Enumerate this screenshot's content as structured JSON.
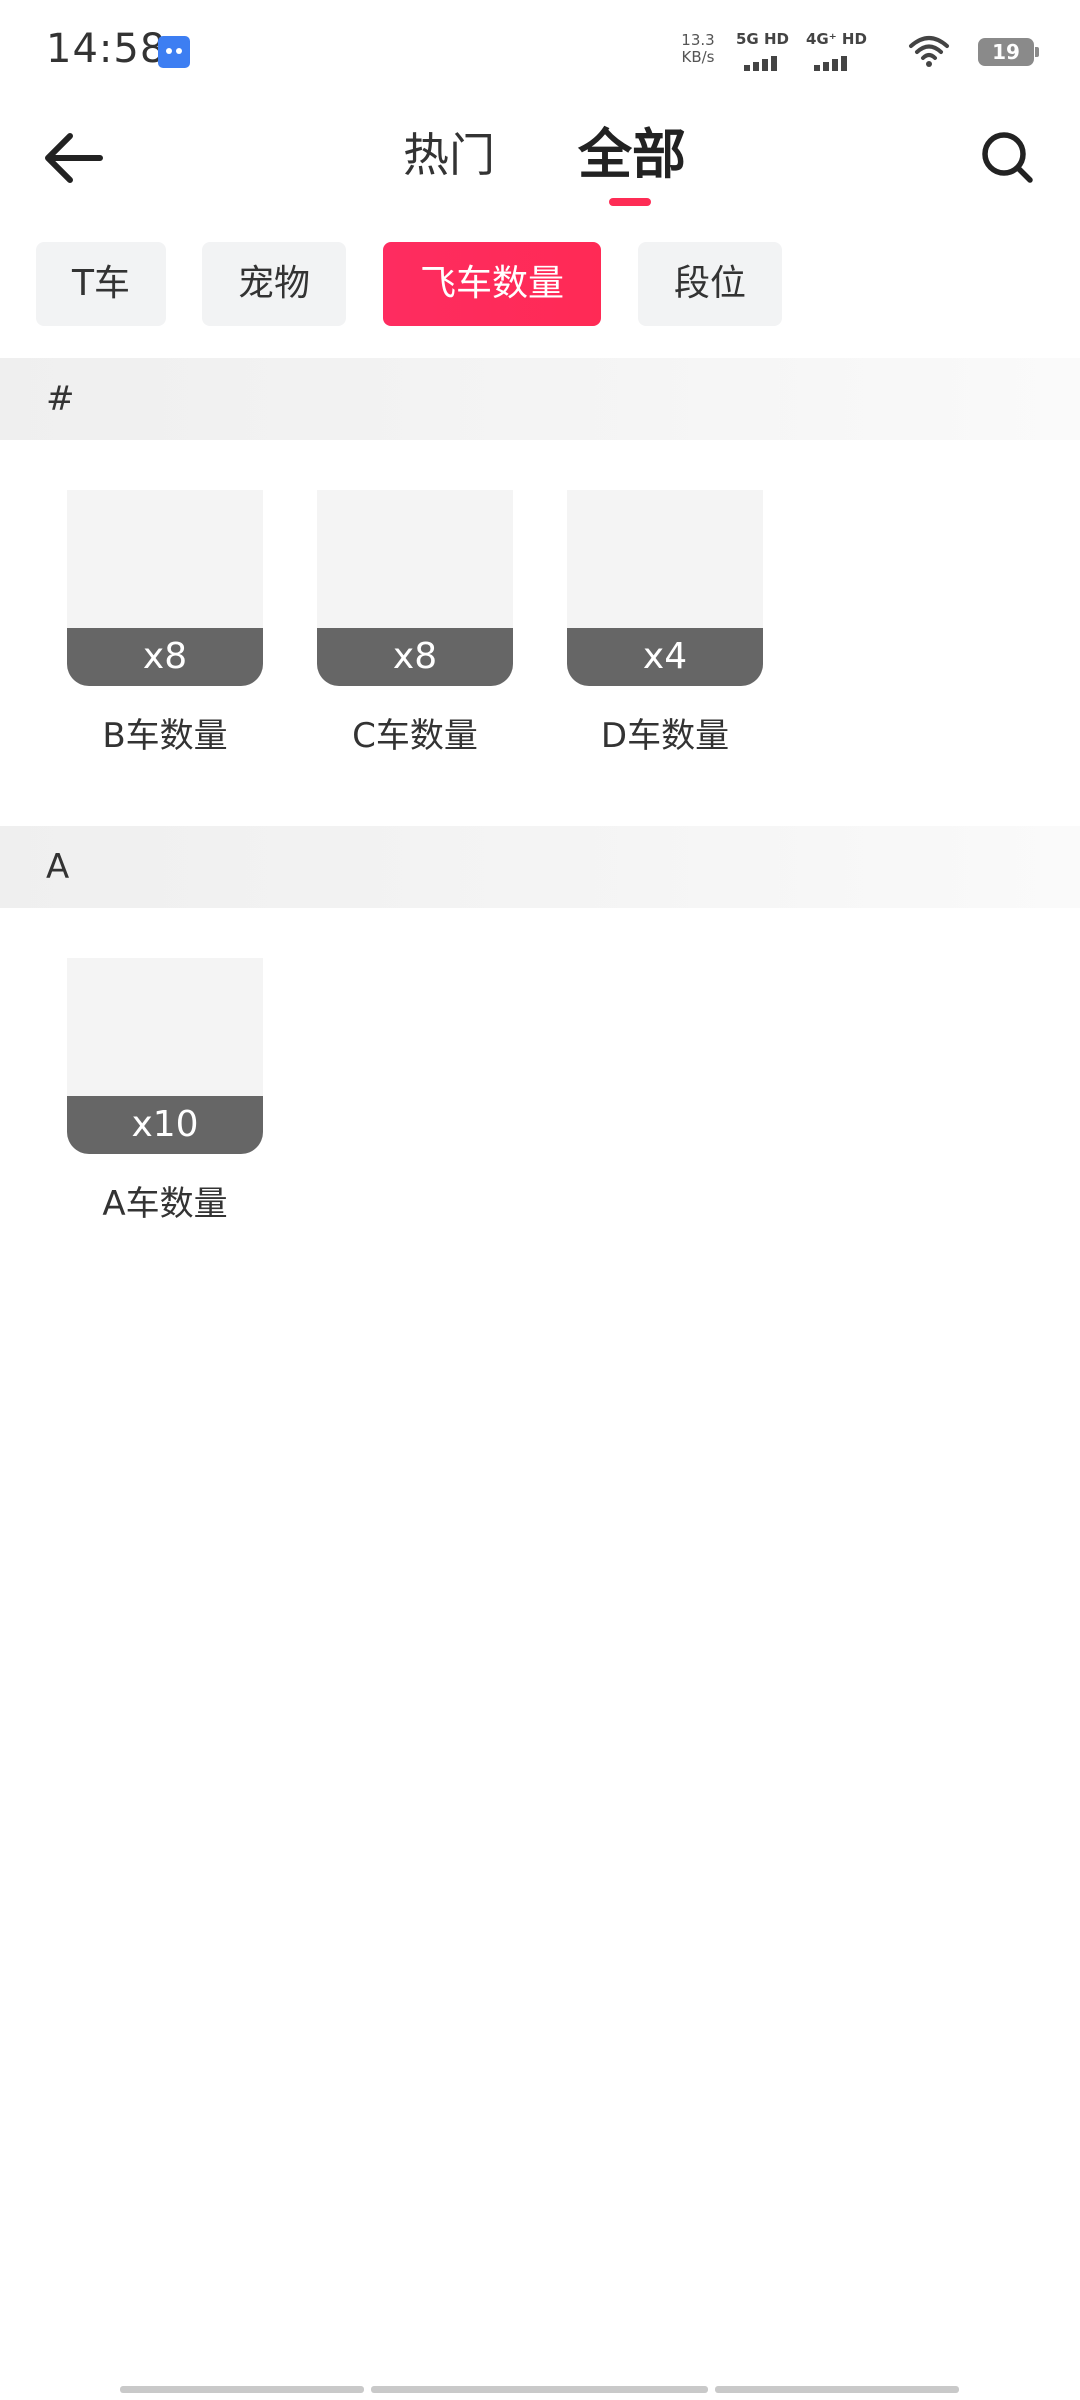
{
  "status_bar": {
    "time": "14:58",
    "app_icon": "chat-icon",
    "net_speed_value": "13.3",
    "net_speed_unit": "KB/s",
    "signal_1_label": "5G HD",
    "signal_2_label": "4G⁺ HD",
    "battery_level": "19"
  },
  "header": {
    "back_icon": "arrow-left-icon",
    "search_icon": "search-icon",
    "tabs": [
      {
        "label": "热门",
        "active": false
      },
      {
        "label": "全部",
        "active": true
      }
    ],
    "accent_color": "#fe2c55"
  },
  "chips": [
    {
      "label": "T车",
      "selected": false
    },
    {
      "label": "宠物",
      "selected": false
    },
    {
      "label": "飞车数量",
      "selected": true
    },
    {
      "label": "段位",
      "selected": false
    }
  ],
  "sections": [
    {
      "title": "#",
      "items": [
        {
          "count": "x8",
          "label": "B车数量"
        },
        {
          "count": "x8",
          "label": "C车数量"
        },
        {
          "count": "x4",
          "label": "D车数量"
        }
      ]
    },
    {
      "title": "A",
      "items": [
        {
          "count": "x10",
          "label": "A车数量"
        }
      ]
    }
  ]
}
